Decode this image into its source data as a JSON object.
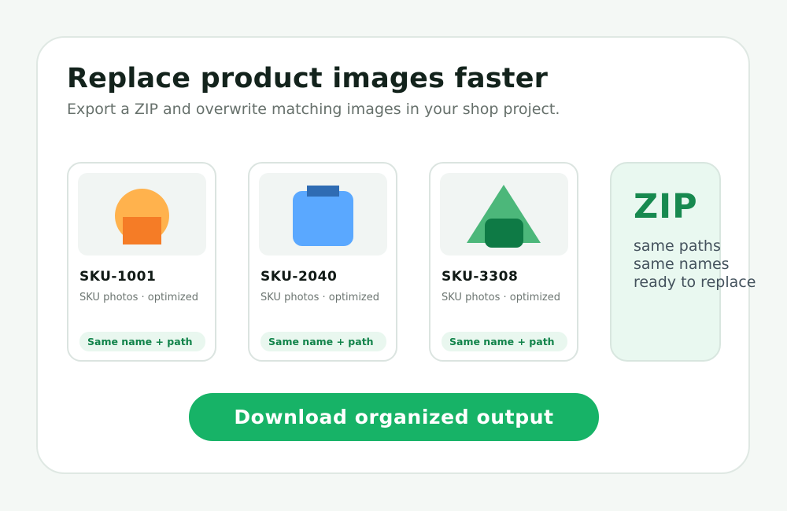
{
  "hero": {
    "title": "Replace product images faster",
    "subtitle": "Export a ZIP and overwrite matching images in your shop project."
  },
  "cards": [
    {
      "sku": "SKU-1001",
      "description": "SKU photos · optimized",
      "tag": "Same name + path",
      "thumbnail_icon": "orange-circle-square-icon"
    },
    {
      "sku": "SKU-2040",
      "description": "SKU photos · optimized",
      "tag": "Same name + path",
      "thumbnail_icon": "blue-jar-icon"
    },
    {
      "sku": "SKU-3308",
      "description": "SKU photos · optimized",
      "tag": "Same name + path",
      "thumbnail_icon": "green-triangle-icon"
    }
  ],
  "zip": {
    "title": "ZIP",
    "lines": [
      "same paths",
      "same names",
      "ready to replace"
    ]
  },
  "cta": {
    "label": "Download organized output"
  },
  "colors": {
    "accent": "#17b367",
    "zip_green": "#17894f",
    "pill_text": "#11834a",
    "orange_light": "#ffb24d",
    "orange_dark": "#f57c26",
    "blue_light": "#5aa8ff",
    "blue_dark": "#2f6cb3",
    "green_light": "#4cb77a",
    "green_dark": "#0e7a45"
  }
}
